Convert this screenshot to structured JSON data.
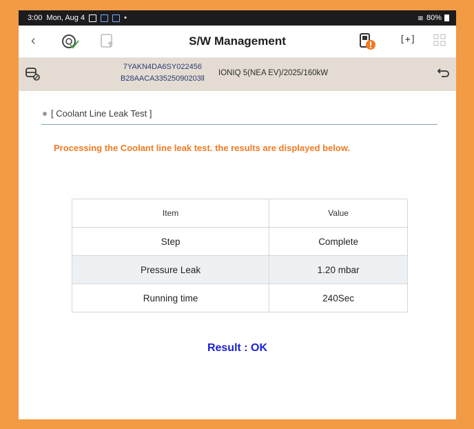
{
  "statusbar": {
    "time": "3:00",
    "date": "Mon, Aug 4",
    "battery": "80%"
  },
  "appbar": {
    "title": "S/W Management"
  },
  "vehicle": {
    "vin_line1": "7YAKN4DA6SY022456",
    "vin_line2": "B28AACA33525090203ll",
    "model": "IONIQ 5(NEA EV)/2025/160kW"
  },
  "section": {
    "title": "[ Coolant Line Leak Test ]"
  },
  "message": "Processing the Coolant line leak test. the results are displayed below.",
  "table": {
    "headers": [
      "Item",
      "Value"
    ],
    "rows": [
      [
        "Step",
        "Complete"
      ],
      [
        "Pressure Leak",
        "1.20 mbar"
      ],
      [
        "Running time",
        "240Sec"
      ]
    ]
  },
  "result": "Result : OK",
  "colors": {
    "accent_orange": "#F07A22",
    "result_blue": "#1B21D6",
    "frame_orange": "#F39A45"
  }
}
